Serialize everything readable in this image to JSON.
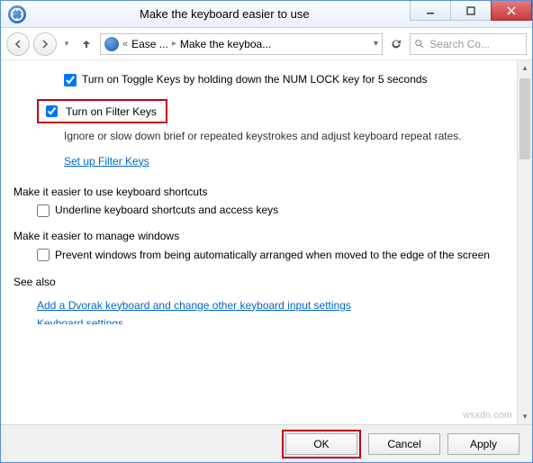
{
  "window": {
    "title": "Make the keyboard easier to use"
  },
  "breadcrumb": {
    "item1": "Ease ...",
    "item2": "Make the keyboa..."
  },
  "search": {
    "placeholder": "Search Co..."
  },
  "toggle_keys": {
    "label": "Turn on Toggle Keys by holding down the NUM LOCK key for 5 seconds"
  },
  "filter_keys": {
    "label": "Turn on Filter Keys",
    "description": "Ignore or slow down brief or repeated keystrokes and adjust keyboard repeat rates.",
    "setup_link": "Set up Filter Keys"
  },
  "shortcuts_section": {
    "header": "Make it easier to use keyboard shortcuts",
    "underline_label": "Underline keyboard shortcuts and access keys"
  },
  "windows_section": {
    "header": "Make it easier to manage windows",
    "prevent_label": "Prevent windows from being automatically arranged when moved to the edge of the screen"
  },
  "see_also": {
    "header": "See also",
    "link1": "Add a Dvorak keyboard and change other keyboard input settings"
  },
  "buttons": {
    "ok": "OK",
    "cancel": "Cancel",
    "apply": "Apply"
  },
  "watermark": "wsxdn.com"
}
